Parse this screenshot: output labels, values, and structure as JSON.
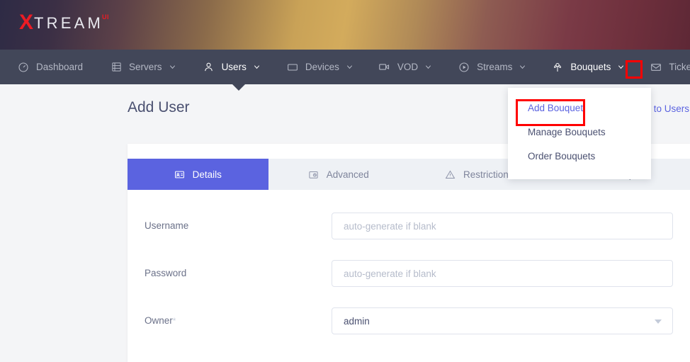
{
  "brand": {
    "logo_x": "X",
    "logo_rest": "TREAM",
    "logo_sup": "UI"
  },
  "nav": {
    "items": [
      {
        "label": "Dashboard",
        "icon": "gauge-icon",
        "caret": false,
        "active": false
      },
      {
        "label": "Servers",
        "icon": "server-icon",
        "caret": true,
        "active": false
      },
      {
        "label": "Users",
        "icon": "user-icon",
        "caret": true,
        "active": true
      },
      {
        "label": "Devices",
        "icon": "device-icon",
        "caret": true,
        "active": false
      },
      {
        "label": "VOD",
        "icon": "video-icon",
        "caret": true,
        "active": false
      },
      {
        "label": "Streams",
        "icon": "play-icon",
        "caret": true,
        "active": false
      },
      {
        "label": "Bouquets",
        "icon": "bouquet-icon",
        "caret": true,
        "active": true
      },
      {
        "label": "Tickets",
        "icon": "envelope-icon",
        "caret": false,
        "active": false
      }
    ]
  },
  "dropdown": {
    "items": [
      {
        "label": "Add Bouquet",
        "highlight": true
      },
      {
        "label": "Manage Bouquets",
        "highlight": false
      },
      {
        "label": "Order Bouquets",
        "highlight": false
      }
    ]
  },
  "page": {
    "title": "Add User",
    "back_link": "Back to Users"
  },
  "tabs": [
    {
      "label": "Details",
      "icon": "id-card-icon",
      "active": true
    },
    {
      "label": "Advanced",
      "icon": "settings-icon",
      "active": false
    },
    {
      "label": "Restrictions",
      "icon": "warning-icon",
      "active": false
    },
    {
      "label": "Bouquets",
      "icon": "bouquet-icon",
      "active": false
    }
  ],
  "form": {
    "fields": [
      {
        "label": "Username",
        "type": "text",
        "value": "",
        "placeholder": "auto-generate if blank",
        "required": false,
        "name": "username-input"
      },
      {
        "label": "Password",
        "type": "text",
        "value": "",
        "placeholder": "auto-generate if blank",
        "required": false,
        "name": "password-input"
      },
      {
        "label": "Owner",
        "type": "select",
        "value": "admin",
        "placeholder": "",
        "required": true,
        "required_mark": "*",
        "name": "owner-select"
      }
    ]
  },
  "colors": {
    "accent": "#5b63e0",
    "navbar": "#424759",
    "logo_red": "#ec1c24",
    "annotation": "#ff0000",
    "page_bg": "#f4f5f7",
    "tab_bar": "#eef1f5"
  },
  "annotations": [
    {
      "target": "bouquets-nav-caret",
      "color": "#ff0000"
    },
    {
      "target": "dropdown-item-add-bouquet",
      "color": "#ff0000"
    }
  ]
}
